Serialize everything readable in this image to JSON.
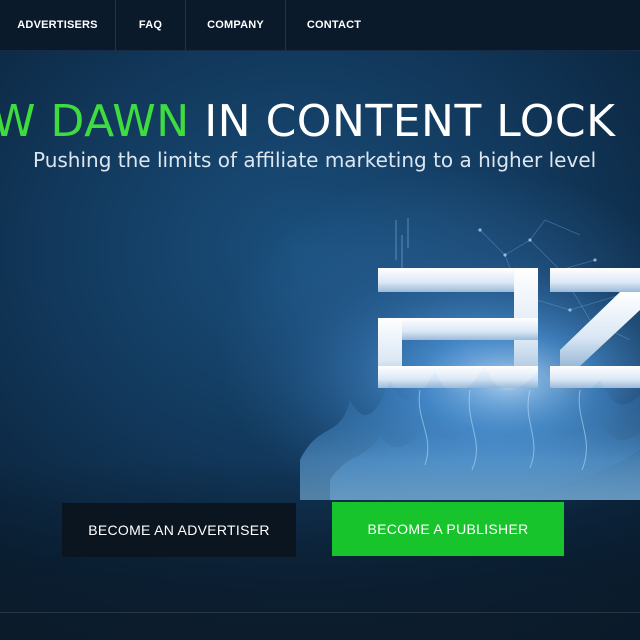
{
  "nav": {
    "items": [
      {
        "label": "ADVERTISERS"
      },
      {
        "label": "FAQ"
      },
      {
        "label": "COMPANY"
      },
      {
        "label": "CONTACT"
      }
    ]
  },
  "hero": {
    "headline_green": "W DAWN",
    "headline_white": " IN CONTENT LOCK",
    "subheadline": "Pushing the limits of affiliate marketing to a higher level"
  },
  "buttons": {
    "advertiser": "BECOME AN ADVERTISER",
    "publisher": "BECOME A PUBLISHER"
  },
  "colors": {
    "accent_green": "#3fdc3f",
    "publisher_button": "#17c42b",
    "nav_background": "#0a1a2b"
  },
  "logo": {
    "icon": "glowing-az-logo-icon"
  }
}
